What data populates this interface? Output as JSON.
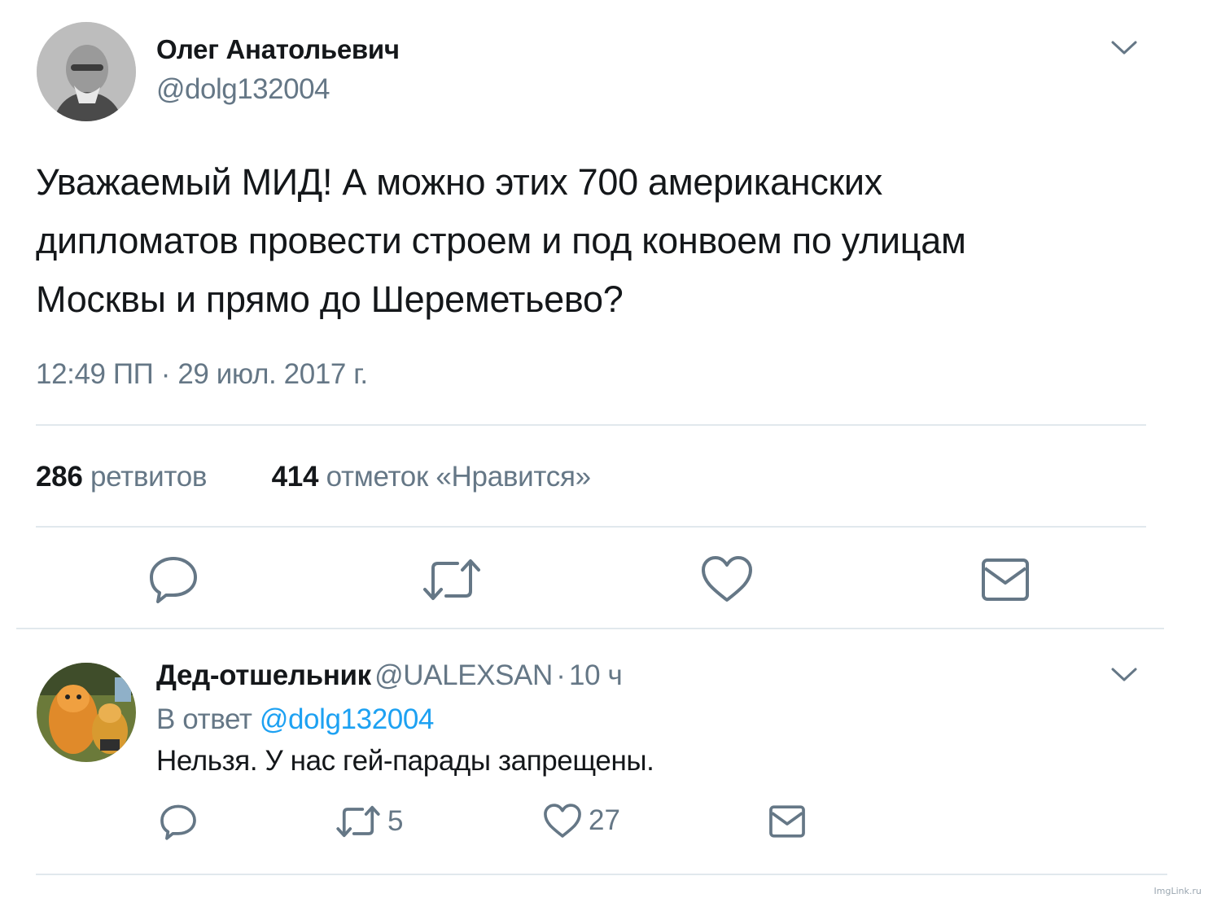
{
  "tweet": {
    "author_name": "Олег Анатольевич",
    "author_handle": "@dolg132004",
    "text_lines": [
      "Уважаемый МИД! А можно этих 700 американских",
      "дипломатов провести строем и под конвоем по улицам",
      "Москвы и прямо до Шереметьево?"
    ],
    "timestamp": "12:49 ПП · 29 июл. 2017 г.",
    "retweets_count": "286",
    "retweets_label": "ретвитов",
    "likes_count": "414",
    "likes_label": "отметок «Нравится»"
  },
  "reply": {
    "author_name": "Дед-отшельник",
    "author_handle": "@UALEXSAN",
    "separator": "·",
    "time": "10 ч",
    "reply_to_prefix": "В ответ",
    "reply_to_handle": "@dolg132004",
    "text": "Нельзя. У нас гей-парады запрещены.",
    "retweet_count": "5",
    "like_count": "27"
  },
  "icons": {
    "menu": "chevron-down-icon",
    "reply": "reply-icon",
    "retweet": "retweet-icon",
    "like": "heart-icon",
    "dm": "envelope-icon"
  },
  "colors": {
    "text": "#14171a",
    "secondary": "#657786",
    "link": "#1da1f2",
    "divider": "#e1e8ed"
  },
  "watermark": "ImgLink.ru"
}
